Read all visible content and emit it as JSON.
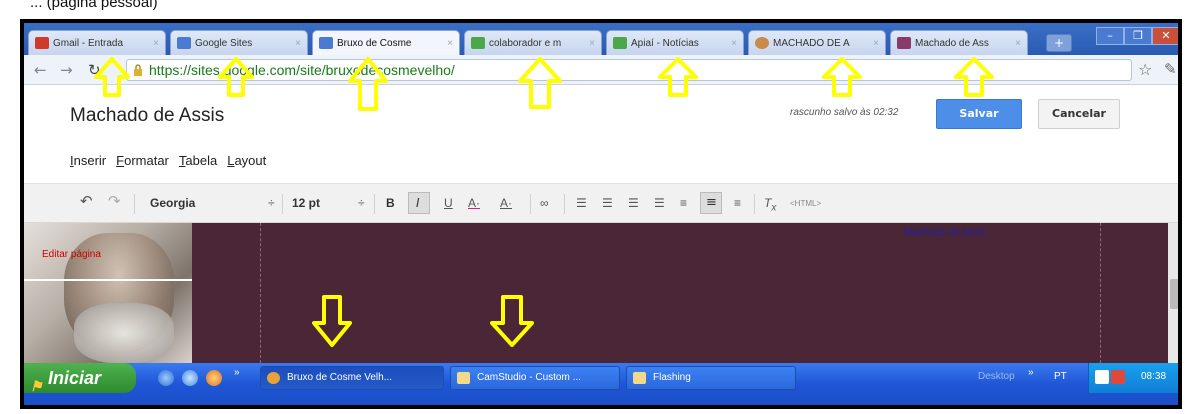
{
  "caption": "... (pagina pessoal)",
  "tabs": [
    {
      "label": "Gmail - Entrada",
      "color": "#cc3b2c",
      "active": false
    },
    {
      "label": "Google Sites",
      "color": "#4a7bd0",
      "active": false
    },
    {
      "label": "Bruxo de Cosme",
      "color": "#4a7bd0",
      "active": true
    },
    {
      "label": "colaborador e m",
      "color": "#4ca64c",
      "active": false
    },
    {
      "label": "Apiaí - Notícias",
      "color": "#4ca64c",
      "active": false
    },
    {
      "label": "MACHADO DE A",
      "color": "#c98a4a",
      "active": false
    },
    {
      "label": "Machado de Ass",
      "color": "#8a3a6a",
      "active": false
    }
  ],
  "address": {
    "url": "https://sites.google.com/site/bruxodecosmevelho/"
  },
  "editor": {
    "site_title": "Machado de Assis",
    "draft_status": "rascunho salvo às 02:32",
    "save_label": "Salvar",
    "cancel_label": "Cancelar",
    "menu": [
      "Inserir",
      "Formatar",
      "Tabela",
      "Layout"
    ],
    "font_name": "Georgia",
    "font_size": "12 pt",
    "html_label": "<HTML>"
  },
  "content": {
    "overlay_text": "Editar página",
    "heading_link": "Machado de Assis"
  },
  "taskbar": {
    "start_label": "Iniciar",
    "tasks": [
      {
        "label": "Bruxo de Cosme Velh...",
        "color": "#e8a23a"
      },
      {
        "label": "CamStudio - Custom ...",
        "color": "#f0d98a"
      },
      {
        "label": "Flashing",
        "color": "#f0d98a"
      }
    ],
    "desktop_label": "Desktop",
    "lang": "PT",
    "time": "08:38"
  },
  "colors": {
    "arrow": "#ffff00",
    "content_bg": "#4a2636",
    "save_blue": "#4d8ee8"
  }
}
